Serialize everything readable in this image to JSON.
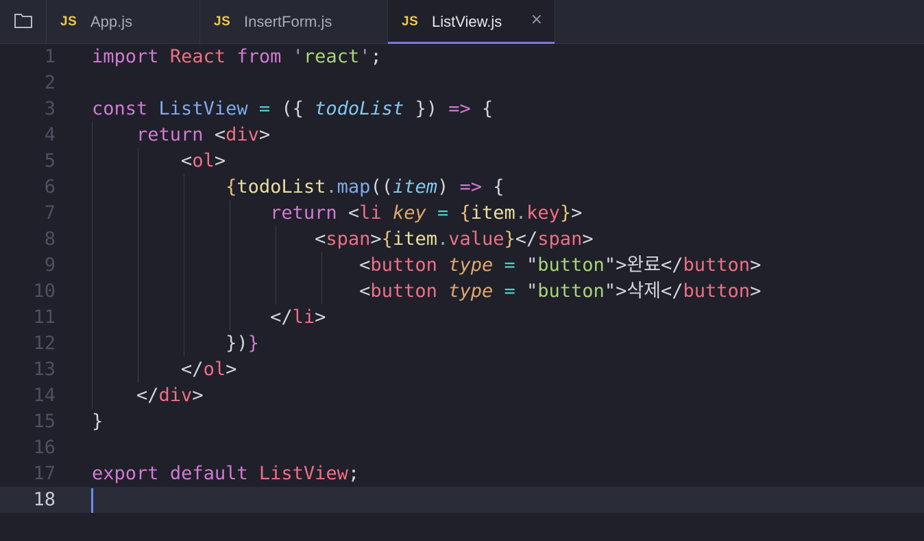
{
  "tabs": [
    {
      "icon": "JS",
      "label": "App.js"
    },
    {
      "icon": "JS",
      "label": "InsertForm.js"
    },
    {
      "icon": "JS",
      "label": "ListView.js",
      "active": true
    }
  ],
  "close_icon": "×",
  "editor": {
    "current_line": 18,
    "lines": [
      [
        {
          "c": "kw",
          "t": "import"
        },
        {
          "c": "pl",
          "t": " "
        },
        {
          "c": "cls",
          "t": "React"
        },
        {
          "c": "pl",
          "t": " "
        },
        {
          "c": "kw",
          "t": "from"
        },
        {
          "c": "pl",
          "t": " "
        },
        {
          "c": "pn",
          "t": "'"
        },
        {
          "c": "str",
          "t": "react"
        },
        {
          "c": "pn",
          "t": "'"
        },
        {
          "c": "pl",
          "t": ";"
        }
      ],
      [],
      [
        {
          "c": "kw",
          "t": "const"
        },
        {
          "c": "pl",
          "t": " "
        },
        {
          "c": "fn",
          "t": "ListView"
        },
        {
          "c": "pl",
          "t": " "
        },
        {
          "c": "op",
          "t": "="
        },
        {
          "c": "pl",
          "t": " ({ "
        },
        {
          "c": "par2",
          "t": "todoList"
        },
        {
          "c": "pl",
          "t": " }) "
        },
        {
          "c": "kw",
          "t": "=>"
        },
        {
          "c": "pl",
          "t": " {"
        }
      ],
      [
        {
          "c": "pl",
          "t": "    "
        },
        {
          "c": "kw",
          "t": "return"
        },
        {
          "c": "pl",
          "t": " <"
        },
        {
          "c": "tag",
          "t": "div"
        },
        {
          "c": "pl",
          "t": ">"
        }
      ],
      [
        {
          "c": "pl",
          "t": "        <"
        },
        {
          "c": "tag",
          "t": "ol"
        },
        {
          "c": "pl",
          "t": ">"
        }
      ],
      [
        {
          "c": "pl",
          "t": "            "
        },
        {
          "c": "br2",
          "t": "{"
        },
        {
          "c": "id",
          "t": "todoList"
        },
        {
          "c": "pn",
          "t": "."
        },
        {
          "c": "fn",
          "t": "map"
        },
        {
          "c": "pl",
          "t": "(("
        },
        {
          "c": "par2",
          "t": "item"
        },
        {
          "c": "pl",
          "t": ") "
        },
        {
          "c": "kw",
          "t": "=>"
        },
        {
          "c": "pl",
          "t": " {"
        }
      ],
      [
        {
          "c": "pl",
          "t": "                "
        },
        {
          "c": "kw",
          "t": "return"
        },
        {
          "c": "pl",
          "t": " <"
        },
        {
          "c": "tag",
          "t": "li"
        },
        {
          "c": "pl",
          "t": " "
        },
        {
          "c": "attr",
          "t": "key"
        },
        {
          "c": "pl",
          "t": " "
        },
        {
          "c": "op",
          "t": "="
        },
        {
          "c": "pl",
          "t": " "
        },
        {
          "c": "br2",
          "t": "{"
        },
        {
          "c": "id",
          "t": "item"
        },
        {
          "c": "pn",
          "t": "."
        },
        {
          "c": "tag",
          "t": "key"
        },
        {
          "c": "br2",
          "t": "}"
        },
        {
          "c": "pl",
          "t": ">"
        }
      ],
      [
        {
          "c": "pl",
          "t": "                    <"
        },
        {
          "c": "tag",
          "t": "span"
        },
        {
          "c": "pl",
          "t": ">"
        },
        {
          "c": "br2",
          "t": "{"
        },
        {
          "c": "id",
          "t": "item"
        },
        {
          "c": "pn",
          "t": "."
        },
        {
          "c": "tag",
          "t": "value"
        },
        {
          "c": "br2",
          "t": "}"
        },
        {
          "c": "pl",
          "t": "</"
        },
        {
          "c": "tag",
          "t": "span"
        },
        {
          "c": "pl",
          "t": ">"
        }
      ],
      [
        {
          "c": "pl",
          "t": "                        <"
        },
        {
          "c": "tag",
          "t": "button"
        },
        {
          "c": "pl",
          "t": " "
        },
        {
          "c": "attr",
          "t": "type"
        },
        {
          "c": "pl",
          "t": " "
        },
        {
          "c": "op",
          "t": "="
        },
        {
          "c": "pl",
          "t": " \""
        },
        {
          "c": "str",
          "t": "button"
        },
        {
          "c": "pl",
          "t": "\">완료</"
        },
        {
          "c": "tag",
          "t": "button"
        },
        {
          "c": "pl",
          "t": ">"
        }
      ],
      [
        {
          "c": "pl",
          "t": "                        <"
        },
        {
          "c": "tag",
          "t": "button"
        },
        {
          "c": "pl",
          "t": " "
        },
        {
          "c": "attr",
          "t": "type"
        },
        {
          "c": "pl",
          "t": " "
        },
        {
          "c": "op",
          "t": "="
        },
        {
          "c": "pl",
          "t": " \""
        },
        {
          "c": "str",
          "t": "button"
        },
        {
          "c": "pl",
          "t": "\">삭제</"
        },
        {
          "c": "tag",
          "t": "button"
        },
        {
          "c": "pl",
          "t": ">"
        }
      ],
      [
        {
          "c": "pl",
          "t": "                </"
        },
        {
          "c": "tag",
          "t": "li"
        },
        {
          "c": "pl",
          "t": ">"
        }
      ],
      [
        {
          "c": "pl",
          "t": "            })"
        },
        {
          "c": "br",
          "t": "}"
        }
      ],
      [
        {
          "c": "pl",
          "t": "        </"
        },
        {
          "c": "tag",
          "t": "ol"
        },
        {
          "c": "pl",
          "t": ">"
        }
      ],
      [
        {
          "c": "pl",
          "t": "    </"
        },
        {
          "c": "tag",
          "t": "div"
        },
        {
          "c": "pl",
          "t": ">"
        }
      ],
      [
        {
          "c": "pl",
          "t": "}"
        }
      ],
      [],
      [
        {
          "c": "kw",
          "t": "export"
        },
        {
          "c": "pl",
          "t": " "
        },
        {
          "c": "kw",
          "t": "default"
        },
        {
          "c": "pl",
          "t": " "
        },
        {
          "c": "cls",
          "t": "ListView"
        },
        {
          "c": "pl",
          "t": ";"
        }
      ],
      []
    ],
    "line_numbers": [
      "1",
      "2",
      "3",
      "4",
      "5",
      "6",
      "7",
      "8",
      "9",
      "10",
      "11",
      "12",
      "13",
      "14",
      "15",
      "16",
      "17",
      "18"
    ]
  },
  "colors": {
    "background": "#1f2029",
    "tab_bar": "#262833",
    "accent": "#7c79d8",
    "js_icon": "#f2c94c",
    "cursor": "#6b8cf0"
  }
}
